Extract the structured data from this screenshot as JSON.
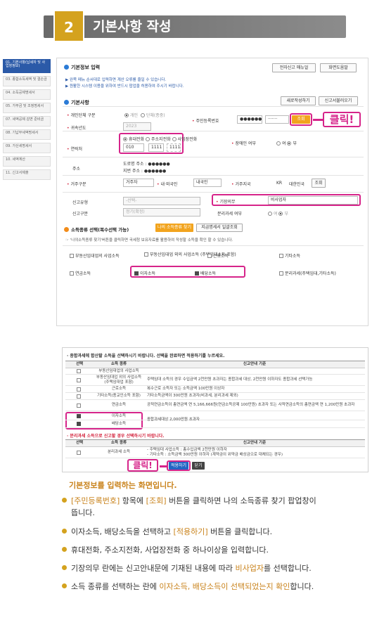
{
  "banner": {
    "number": "2",
    "title": "기본사항 작성"
  },
  "sidebar": {
    "items": [
      "01. 기본사항(납세자 및 사업장정보)",
      "03. 종합소득세액 및 결손금",
      "04. 소득공제명세서",
      "05. 가부금 및 조정명세서",
      "07. 세액공제 감면 준비금",
      "08. 기납부세액명세서",
      "09. 가산세명세서",
      "10. 세액계산",
      "11. 신고서제출"
    ]
  },
  "form": {
    "section1_title": "기본정보 입력",
    "manual_btn": "전자신고 매뉴얼",
    "screen_btn": "화면도움말",
    "note1": "▶ 완쪽 메뉴 순서대로 입력하면 계산 오류를 줄일 수 있습니다.",
    "note2": "▶ 원활한 시스템 이용을 위하여 반드시 팝업을 허용하여 주시기 바랍니다.",
    "section2_title": "기본사항",
    "new_btn": "새로작성하기",
    "load_btn": "신고서불러오기",
    "taxpayer_type_label": "개인단체 구분",
    "taxpayer_type_opt1": "개인",
    "taxpayer_type_opt2": "단체(종중)",
    "resident_no_label": "주민등록번호",
    "resident_no_front": "●●●●●●",
    "resident_no_back": "·······",
    "lookup_btn": "조회",
    "year_label": "귀속년도",
    "year_value": "2023",
    "contact_label": "연락처",
    "contact_opt1": "휴대전화",
    "contact_opt2": "주소지전화",
    "contact_opt3": "사업장전화",
    "phone1": "010",
    "phone2": "1111",
    "phone3": "1111",
    "disabled_label": "장애인 여부",
    "disabled_opt1": "여",
    "disabled_opt2": "부",
    "address_label": "주소",
    "road_addr": "도로명 주소 : ●●●●●●",
    "lot_addr": "지번 주소 : ●●●●●●",
    "residence_label": "거주구분",
    "residence_value": "거주자",
    "foreign_label": "내·외국인",
    "foreign_value": "내국인",
    "country_label": "거주지국",
    "country_code": "KR",
    "country_name": "대한민국",
    "country_btn": "조회",
    "report_type_label": "신고유형",
    "report_type_value": "-선택-",
    "bookkeeping_label": "기장의무",
    "bookkeeping_value": "비사업자",
    "report_kind_label": "신고구분",
    "report_kind_value": "정기(확정)",
    "separate_label": "분리과세 여부",
    "separate_opt1": "여",
    "separate_opt2": "부",
    "section3_title": "소득종류 선택(복수선택 가능)",
    "find_income_btn": "나의 소득종류 찾기",
    "payment_btn": "지급명세서 일괄조회",
    "section3_note": "☞ '나의소득종류 찾기'버튼을 클릭하면 국세청 보유자료를 활용하여 작성할 소득을 확인 할 수 있습니다.",
    "income_types": [
      "부동산임대업의 사업소득",
      "부동산임대업 외의 사업소득 (주택임대소득 포함)",
      "근로소득",
      "기타소득",
      "연금소득",
      "이자소득",
      "배당소득",
      "분리과세(주택임대,기타소득)"
    ],
    "click_label": "클릭!"
  },
  "popup": {
    "title1": "· 종합과세에 합산할 소득을 선택하시기 바랍니다. 선택을 완료하면 적용하기를 누르세요.",
    "col_select": "선택",
    "col_kind": "소득 종류",
    "col_guide": "신고안내 기준",
    "rows": [
      {
        "kind": "부동산임대업의 사업소득",
        "guide": ""
      },
      {
        "kind": "부동산임대업 외의 사업소득 (주택임대업 포함)",
        "guide": "주택임대 소득의 경우 수입금액 2천만원 초과자는 종합과세 대상, 2천만원 이하자도 종합과세 선택가능"
      },
      {
        "kind": "근로소득",
        "guide": "복수근로 소득자 또는 소득금액 100만원 이상자"
      },
      {
        "kind": "기타소득(종교인소득 포함)",
        "guide": "기타소득금액이 300만원 초과자(비과세, 분리과세 제외)"
      },
      {
        "kind": "연금소득",
        "guide": "공적연금소득이 총연금액 연 5,166,666원(연금소득공제 100만원) 초과자 또는 사적연금소득의 총연금액 연 1,200만원 초과자"
      },
      {
        "kind": "이자소득",
        "guide": "종합과세대상 2,000만원 초과자"
      },
      {
        "kind": "배당소득",
        "guide": ""
      }
    ],
    "title2": "· 분리과세 소득으로 신고할 경우 선택하시기 바랍니다.",
    "sep_row_kind": "분리과세 소득",
    "sep_row_guide1": "- 주택임대 사업소득 : 총수입금액 2천만원 이하자",
    "sep_row_guide2": "- 기타소득 : 소득금액 300만원 이하자 (계약금이 위약금 배상금으로 대체되는 경우)",
    "click_label": "클릭!",
    "apply_btn": "적용하기",
    "close_btn": "닫기"
  },
  "description": {
    "title": "기본정보를 입력하는 화면입니다.",
    "b1_pre": "",
    "b1_em1": "[주민등록번호]",
    "b1_mid": " 항목에 ",
    "b1_em2": "[조회]",
    "b1_post": " 버튼을 클릭하면 나의 소득종류 찾기 팝업창이",
    "b1_line2": "뜹니다.",
    "b2_pre": "이자소득, 배당소득을 선택하고 ",
    "b2_em": "[적용하기]",
    "b2_post": " 버튼을 클릭합니다.",
    "b3": "휴대전화, 주소지전화, 사업장전화 중 하나이상을 입력합니다.",
    "b4_pre": "기장의무 란에는 신고안내문에 기재된 내용에 따라 ",
    "b4_em": "비사업자",
    "b4_post": "를 선택합니다.",
    "b5_pre": "소득 종류를 선택하는 란에 ",
    "b5_em": "이자소득, 배당소득이 선택되었는지 확인",
    "b5_post": "합니다."
  }
}
